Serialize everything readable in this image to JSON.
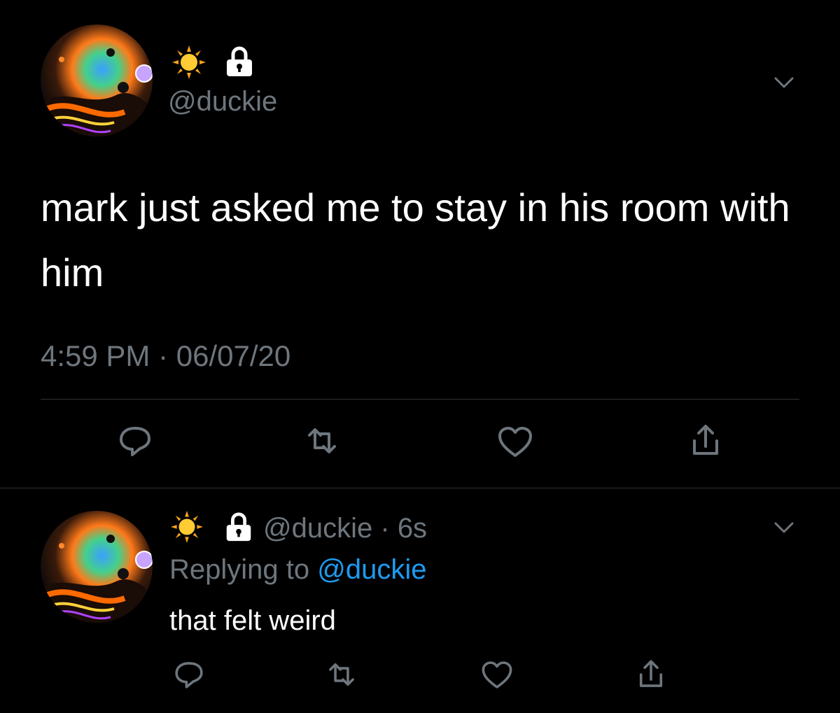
{
  "main_tweet": {
    "handle": "@duckie",
    "text": "mark just asked me to stay in his room with him",
    "timestamp": "4:59 PM · 06/07/20",
    "icons": [
      "sun-emoji",
      "lock-icon",
      "chevron-down-icon"
    ],
    "actions": [
      "reply-icon",
      "retweet-icon",
      "like-icon",
      "share-icon"
    ]
  },
  "reply_tweet": {
    "handle": "@duckie",
    "separator": "·",
    "age": "6s",
    "replying_prefix": "Replying to",
    "replying_handle": "@duckie",
    "text": "that felt weird",
    "icons": [
      "sun-emoji",
      "lock-icon",
      "chevron-down-icon"
    ],
    "actions": [
      "reply-icon",
      "retweet-icon",
      "like-icon",
      "share-icon"
    ]
  },
  "colors": {
    "background": "#000000",
    "text": "#ffffff",
    "muted": "#6e767d",
    "link": "#1d9bf0",
    "divider": "#2f3336"
  }
}
